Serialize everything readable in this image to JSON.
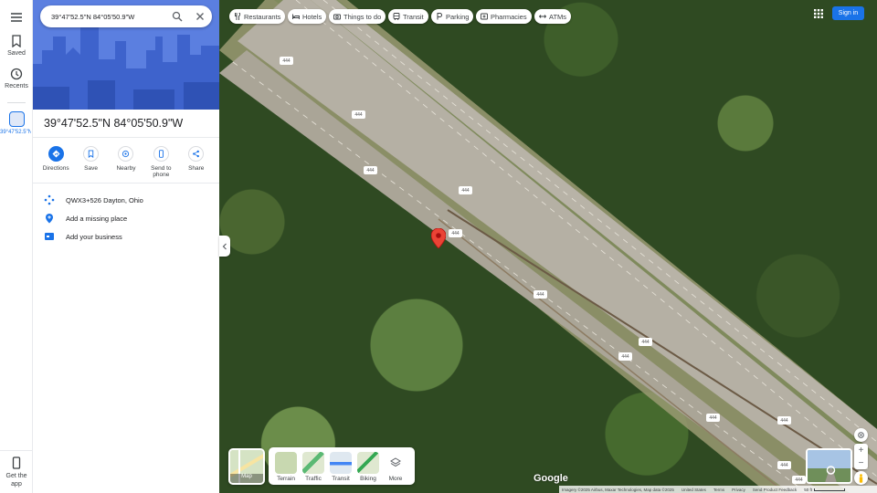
{
  "search": {
    "query": "39°47'52.5\"N 84°05'50.9\"W"
  },
  "rail": {
    "saved": "Saved",
    "recents": "Recents",
    "recent_place": "39°47'52.5\"N",
    "get_app": "Get the app"
  },
  "place": {
    "title": "39°47'52.5\"N 84°05'50.9\"W",
    "plus_code": "QWX3+526 Dayton, Ohio",
    "add_missing": "Add a missing place",
    "add_business": "Add your business"
  },
  "actions": [
    {
      "label": "Directions",
      "icon": "directions-icon"
    },
    {
      "label": "Save",
      "icon": "bookmark-icon"
    },
    {
      "label": "Nearby",
      "icon": "nearby-icon"
    },
    {
      "label": "Send to phone",
      "icon": "phone-icon"
    },
    {
      "label": "Share",
      "icon": "share-icon"
    }
  ],
  "chips": [
    "Restaurants",
    "Hotels",
    "Things to do",
    "Transit",
    "Parking",
    "Pharmacies",
    "ATMs"
  ],
  "header": {
    "sign_in": "Sign in"
  },
  "layers": {
    "map": "Map",
    "items": [
      "Terrain",
      "Traffic",
      "Transit",
      "Biking",
      "More"
    ]
  },
  "highway_label": "444",
  "footer": {
    "imagery": "Imagery ©2025 Airbus, Maxar Technologies, Map data ©2025",
    "country": "United States",
    "terms": "Terms",
    "privacy": "Privacy",
    "feedback": "Send Product Feedback",
    "scale": "50 ft"
  },
  "google": "Google",
  "colors": {
    "accent": "#1a73e8",
    "pin": "#ea4335"
  }
}
